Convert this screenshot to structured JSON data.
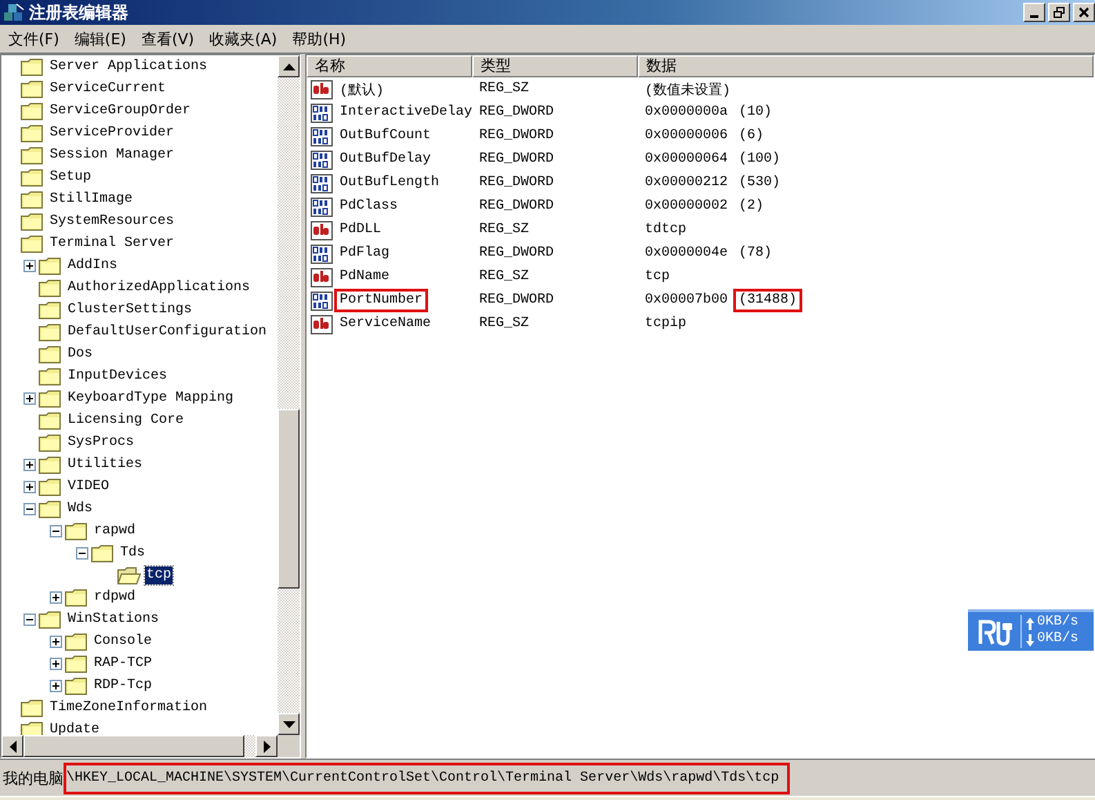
{
  "window": {
    "title": "注册表编辑器"
  },
  "menu": [
    "文件(F)",
    "编辑(E)",
    "查看(V)",
    "收藏夹(A)",
    "帮助(H)"
  ],
  "tree": [
    {
      "label": "Server Applications"
    },
    {
      "label": "ServiceCurrent"
    },
    {
      "label": "ServiceGroupOrder"
    },
    {
      "label": "ServiceProvider"
    },
    {
      "label": "Session Manager"
    },
    {
      "label": "Setup"
    },
    {
      "label": "StillImage"
    },
    {
      "label": "SystemResources"
    },
    {
      "label": "Terminal Server",
      "children": [
        {
          "label": "AddIns",
          "expanded": false
        },
        {
          "label": "AuthorizedApplications"
        },
        {
          "label": "ClusterSettings"
        },
        {
          "label": "DefaultUserConfiguration"
        },
        {
          "label": "Dos"
        },
        {
          "label": "InputDevices"
        },
        {
          "label": "KeyboardType Mapping",
          "expanded": false
        },
        {
          "label": "Licensing Core"
        },
        {
          "label": "SysProcs"
        },
        {
          "label": "Utilities",
          "expanded": false
        },
        {
          "label": "VIDEO",
          "expanded": false
        },
        {
          "label": "Wds",
          "expanded": true,
          "children": [
            {
              "label": "rapwd",
              "expanded": true,
              "children": [
                {
                  "label": "Tds",
                  "expanded": true,
                  "children": [
                    {
                      "label": "tcp",
                      "selected": true
                    }
                  ]
                }
              ]
            },
            {
              "label": "rdpwd",
              "expanded": false
            }
          ]
        },
        {
          "label": "WinStations",
          "expanded": true,
          "children": [
            {
              "label": "Console",
              "expanded": false
            },
            {
              "label": "RAP-TCP",
              "expanded": false
            },
            {
              "label": "RDP-Tcp",
              "expanded": false
            }
          ]
        }
      ]
    },
    {
      "label": "TimeZoneInformation"
    },
    {
      "label": "Update"
    }
  ],
  "table": {
    "columns": [
      "名称",
      "类型",
      "数据"
    ],
    "rows": [
      {
        "kind": "string",
        "name": "(默认)",
        "type": "REG_SZ",
        "data": "(数值未设置)",
        "highlighted": false
      },
      {
        "kind": "dword",
        "name": "InteractiveDelay",
        "type": "REG_DWORD",
        "data": "0x0000000a",
        "decimal": "(10)",
        "highlighted": false
      },
      {
        "kind": "dword",
        "name": "OutBufCount",
        "type": "REG_DWORD",
        "data": "0x00000006",
        "decimal": "(6)",
        "highlighted": false
      },
      {
        "kind": "dword",
        "name": "OutBufDelay",
        "type": "REG_DWORD",
        "data": "0x00000064",
        "decimal": "(100)",
        "highlighted": false
      },
      {
        "kind": "dword",
        "name": "OutBufLength",
        "type": "REG_DWORD",
        "data": "0x00000212",
        "decimal": "(530)",
        "highlighted": false
      },
      {
        "kind": "dword",
        "name": "PdClass",
        "type": "REG_DWORD",
        "data": "0x00000002",
        "decimal": "(2)",
        "highlighted": false
      },
      {
        "kind": "string",
        "name": "PdDLL",
        "type": "REG_SZ",
        "data": "tdtcp",
        "highlighted": false
      },
      {
        "kind": "dword",
        "name": "PdFlag",
        "type": "REG_DWORD",
        "data": "0x0000004e",
        "decimal": "(78)",
        "highlighted": false
      },
      {
        "kind": "string",
        "name": "PdName",
        "type": "REG_SZ",
        "data": "tcp",
        "highlighted": false
      },
      {
        "kind": "dword",
        "name": "PortNumber",
        "type": "REG_DWORD",
        "data": "0x00007b00",
        "decimal": "(31488)",
        "highlighted": true
      },
      {
        "kind": "string",
        "name": "ServiceName",
        "type": "REG_SZ",
        "data": "tcpip",
        "highlighted": false
      }
    ]
  },
  "network_widget": {
    "upload": "0KB/s",
    "download": "0KB/s"
  },
  "status_bar": {
    "prefix": "我的电脑",
    "path": "\\HKEY_LOCAL_MACHINE\\SYSTEM\\CurrentControlSet\\Control\\Terminal Server\\Wds\\rapwd\\Tds\\tcp",
    "highlighted": true
  }
}
